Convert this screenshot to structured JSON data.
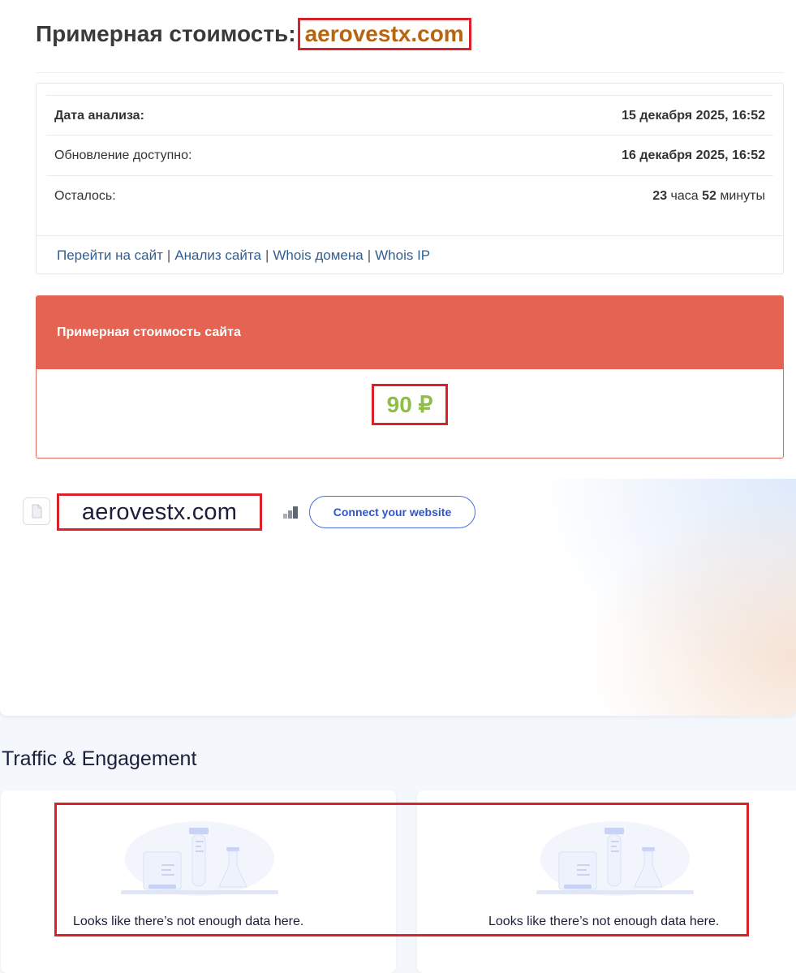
{
  "header": {
    "title_prefix": "Примерная стоимость:",
    "domain": "aerovestx.com"
  },
  "info": {
    "rows": [
      {
        "label": "Дата анализа:",
        "value": "15 декабря 2025, 16:52"
      },
      {
        "label": "Обновление доступно:",
        "value": "16 декабря 2025, 16:52"
      },
      {
        "label": "Осталось:",
        "hours": "23",
        "hours_unit": "часа",
        "minutes": "52",
        "minutes_unit": "минуты"
      }
    ],
    "links": [
      "Перейти на сайт",
      "Анализ сайта",
      "Whois домена",
      "Whois IP"
    ],
    "separator": "|"
  },
  "price": {
    "heading": "Примерная стоимость сайта",
    "value": "90 ₽"
  },
  "site_card": {
    "domain": "aerovestx.com",
    "favicon_icon": "document-icon",
    "rank_icon": "bar-chart-icon",
    "connect_label": "Connect your website"
  },
  "traffic": {
    "title": "Traffic & Engagement",
    "empty_message": "Looks like there’s not enough data here."
  },
  "colors": {
    "highlight": "#d8232a",
    "domain_orange": "#b8650f",
    "price_green": "#8dbf45",
    "price_header": "#e46352",
    "link_blue": "#2e5f94",
    "connect_blue": "#2f55c9"
  }
}
